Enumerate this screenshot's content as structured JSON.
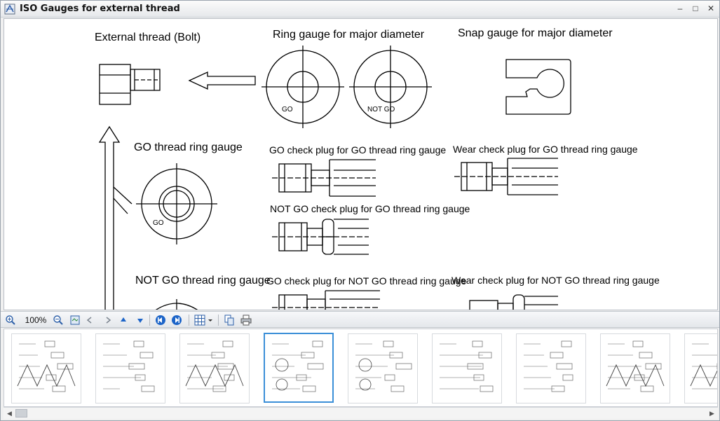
{
  "window": {
    "title": "ISO Gauges for external thread",
    "minimize_glyph": "–",
    "maximize_glyph": "□",
    "close_glyph": "✕"
  },
  "document": {
    "labels": {
      "external_thread": "External thread (Bolt)",
      "ring_gauge_major": "Ring gauge for major diameter",
      "snap_gauge_major": "Snap gauge for major diameter",
      "go_thread_ring": "GO thread ring gauge",
      "go_check_plug": "GO check plug for GO thread ring gauge",
      "wear_check_plug": "Wear check plug for GO thread ring gauge",
      "not_go_check_plug": "NOT GO check plug for GO thread ring gauge",
      "not_go_thread_ring": "NOT GO thread ring gauge",
      "go_check_plug_not_go": "GO check plug for NOT GO thread ring gauge",
      "wear_check_plug_not_go": "Wear check plug for NOT GO thread ring gauge",
      "go_mark": "GO",
      "not_go_mark": "NOT GO"
    }
  },
  "toolbar": {
    "zoom_level": "100%",
    "icons": [
      "zoom-in-icon",
      "zoom-out-icon",
      "fit-page-icon",
      "prev-arrow-icon",
      "next-arrow-icon",
      "page-up-icon",
      "page-down-icon",
      "first-page-icon",
      "last-page-icon",
      "grid-view-icon",
      "copy-icon",
      "print-icon"
    ]
  },
  "thumbnails": {
    "count": 9,
    "selected_index": 3
  },
  "colors": {
    "accent": "#3b8fd8",
    "nav_blue": "#1c64c8"
  }
}
